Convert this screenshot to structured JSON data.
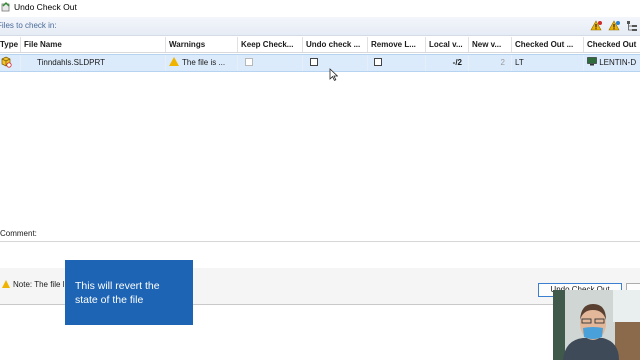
{
  "window": {
    "title": "Undo Check Out"
  },
  "section": {
    "label": "Files to check in:"
  },
  "grid": {
    "columns": [
      "Type",
      "File Name",
      "Warnings",
      "Keep Check...",
      "Undo check ...",
      "Remove L...",
      "Local v...",
      "New v...",
      "Checked Out ...",
      "Checked Out"
    ],
    "row": {
      "file_name": "Tinndahls.SLDPRT",
      "warning": "The file is ...",
      "local_version": "-/2",
      "new_version": "2",
      "checked_out_by": "LT",
      "checked_out_on": "LENTIN-D"
    }
  },
  "comment": {
    "label": "Comment:"
  },
  "footer": {
    "note": "Note: The file l",
    "undo_button": "Undo Check Out"
  },
  "callout": {
    "text": "This will revert the state of the file"
  },
  "colors": {
    "accent": "#1d64b4",
    "selection": "#dcebfb",
    "warning": "#f0b400"
  }
}
